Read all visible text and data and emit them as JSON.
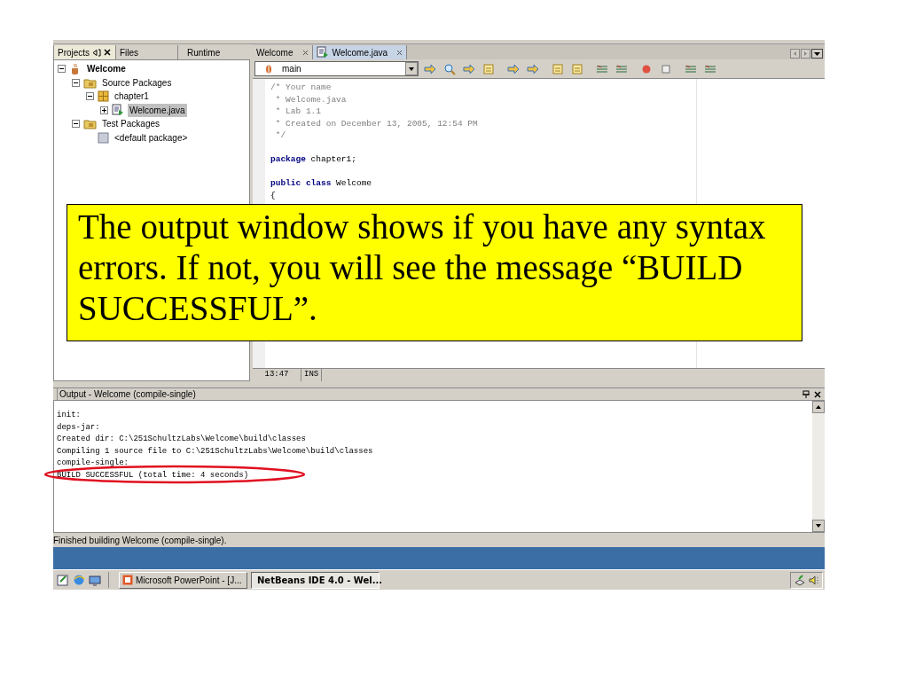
{
  "projects_panel": {
    "tabs": [
      {
        "label": "Projects",
        "selected": true
      },
      {
        "label": "Files",
        "selected": false
      },
      {
        "label": "Runtime",
        "selected": false
      }
    ],
    "tree": [
      {
        "kind": "project",
        "label": "Welcome",
        "expanded": true,
        "selected": false,
        "children": [
          {
            "kind": "folder",
            "label": "Source Packages",
            "expanded": true,
            "selected": false,
            "children": [
              {
                "kind": "package",
                "label": "chapter1",
                "expanded": true,
                "selected": false,
                "children": [
                  {
                    "kind": "java",
                    "label": "Welcome.java",
                    "expanded": false,
                    "selected": true
                  }
                ]
              }
            ]
          },
          {
            "kind": "folder",
            "label": "Test Packages",
            "expanded": true,
            "selected": false,
            "children": [
              {
                "kind": "empty-package",
                "label": "<default package>"
              }
            ]
          }
        ]
      }
    ]
  },
  "editor": {
    "tabs": [
      {
        "label": "Welcome",
        "selected": false
      },
      {
        "label": "Welcome.java",
        "selected": true
      }
    ],
    "member_combo": "main",
    "code": [
      {
        "kind": "comment",
        "text": "/* Your name"
      },
      {
        "kind": "comment",
        "text": " * Welcome.java"
      },
      {
        "kind": "comment",
        "text": " * Lab 1.1"
      },
      {
        "kind": "comment",
        "text": " * Created on December 13, 2005, 12:54 PM"
      },
      {
        "kind": "comment",
        "text": " */"
      },
      {
        "kind": "blank"
      },
      {
        "kind": "code",
        "keyword": "package",
        "text": " chapter1;"
      },
      {
        "kind": "blank"
      },
      {
        "kind": "code",
        "keyword": "public class",
        "text": " Welcome"
      },
      {
        "kind": "plain",
        "text": "{"
      }
    ],
    "status": [
      "13:47",
      "INS"
    ]
  },
  "output": {
    "title": "Output - Welcome (compile-single)",
    "lines": [
      "init:",
      "deps-jar:",
      "Created dir: C:\\251SchultzLabs\\Welcome\\build\\classes",
      "Compiling 1 source file to C:\\251SchultzLabs\\Welcome\\build\\classes",
      "compile-single:",
      "BUILD SUCCESSFUL (total time: 4 seconds)"
    ]
  },
  "status_bar": "Finished building Welcome (compile-single).",
  "taskbar": {
    "tasks": [
      {
        "label": "Microsoft PowerPoint - [J...",
        "selected": false
      },
      {
        "label": "NetBeans IDE 4.0 - Wel...",
        "selected": true
      }
    ]
  },
  "callout": {
    "text": "The output window shows if you have any syntax errors. If not, you will see the message “BUILD SUCCESSFUL”."
  }
}
